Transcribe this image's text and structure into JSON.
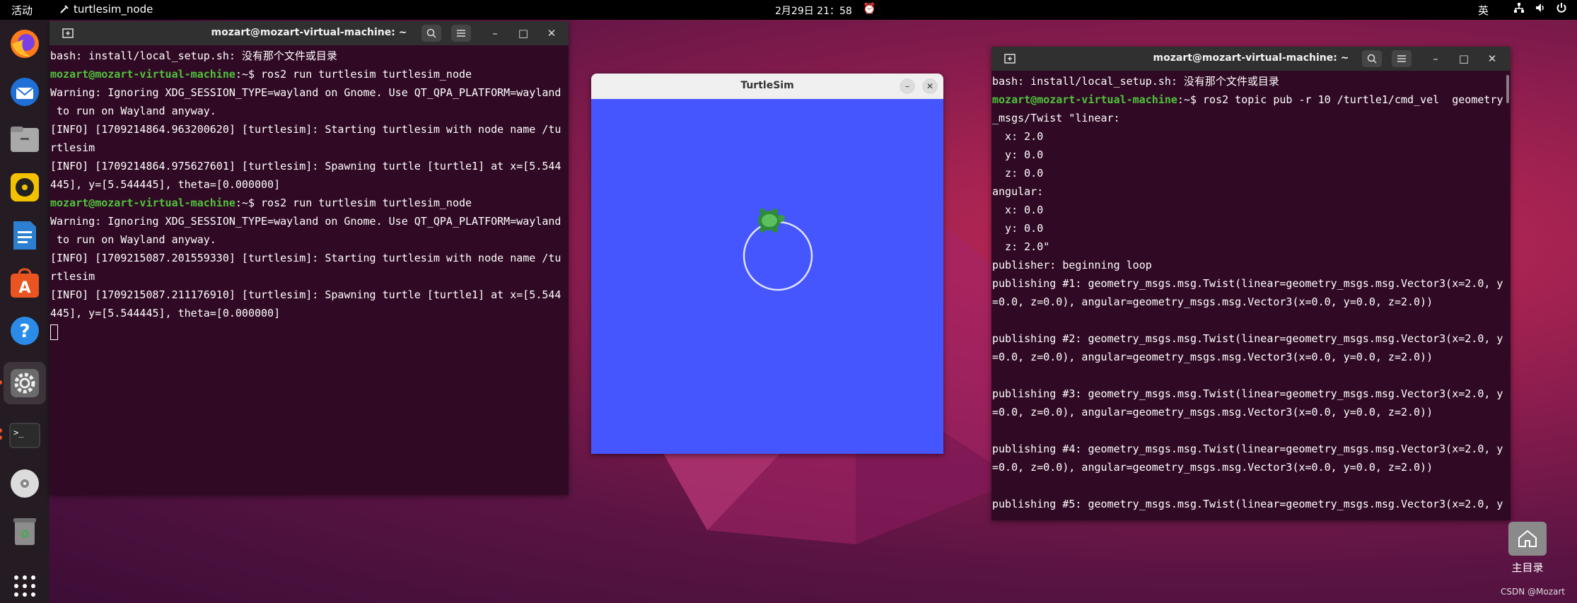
{
  "topbar": {
    "activities": "活动",
    "app_name": "turtlesim_node",
    "clock": "2月29日  21：58",
    "input_method": "英"
  },
  "dock": {
    "items": [
      "firefox-icon",
      "thunderbird-icon",
      "files-icon",
      "rhythmbox-icon",
      "writer-icon",
      "app-center-icon",
      "help-icon",
      "settings-icon",
      "terminal-icon",
      "disc-icon",
      "trash-icon",
      "app-grid-icon"
    ]
  },
  "terminal_left": {
    "title": "mozart@mozart-virtual-machine: ~",
    "lines": [
      {
        "text": "bash: install/local_setup.sh: 没有那个文件或目录"
      },
      {
        "user": "mozart@mozart-virtual-machine",
        "rest": ":~$ ros2 run turtlesim turtlesim_node"
      },
      {
        "text": "Warning: Ignoring XDG_SESSION_TYPE=wayland on Gnome. Use QT_QPA_PLATFORM=wayland"
      },
      {
        "text": " to run on Wayland anyway."
      },
      {
        "text": "[INFO] [1709214864.963200620] [turtlesim]: Starting turtlesim with node name /tu"
      },
      {
        "text": "rtlesim"
      },
      {
        "text": "[INFO] [1709214864.975627601] [turtlesim]: Spawning turtle [turtle1] at x=[5.544"
      },
      {
        "text": "445], y=[5.544445], theta=[0.000000]"
      },
      {
        "user": "mozart@mozart-virtual-machine",
        "rest": ":~$ ros2 run turtlesim turtlesim_node"
      },
      {
        "text": "Warning: Ignoring XDG_SESSION_TYPE=wayland on Gnome. Use QT_QPA_PLATFORM=wayland"
      },
      {
        "text": " to run on Wayland anyway."
      },
      {
        "text": "[INFO] [1709215087.201559330] [turtlesim]: Starting turtlesim with node name /tu"
      },
      {
        "text": "rtlesim"
      },
      {
        "text": "[INFO] [1709215087.211176910] [turtlesim]: Spawning turtle [turtle1] at x=[5.544"
      },
      {
        "text": "445], y=[5.544445], theta=[0.000000]"
      }
    ]
  },
  "turtlesim": {
    "title": "TurtleSim",
    "background_color": "#4556ff"
  },
  "terminal_right": {
    "title": "mozart@mozart-virtual-machine: ~",
    "lines": [
      {
        "text": "bash: install/local_setup.sh: 没有那个文件或目录"
      },
      {
        "user": "mozart@mozart-virtual-machine",
        "rest": ":~$ ros2 topic pub -r 10 /turtle1/cmd_vel  geometry"
      },
      {
        "text": "_msgs/Twist \"linear:"
      },
      {
        "text": "  x: 2.0"
      },
      {
        "text": "  y: 0.0"
      },
      {
        "text": "  z: 0.0"
      },
      {
        "text": "angular:"
      },
      {
        "text": "  x: 0.0"
      },
      {
        "text": "  y: 0.0"
      },
      {
        "text": "  z: 2.0\""
      },
      {
        "text": "publisher: beginning loop"
      },
      {
        "text": "publishing #1: geometry_msgs.msg.Twist(linear=geometry_msgs.msg.Vector3(x=2.0, y"
      },
      {
        "text": "=0.0, z=0.0), angular=geometry_msgs.msg.Vector3(x=0.0, y=0.0, z=2.0))"
      },
      {
        "text": ""
      },
      {
        "text": "publishing #2: geometry_msgs.msg.Twist(linear=geometry_msgs.msg.Vector3(x=2.0, y"
      },
      {
        "text": "=0.0, z=0.0), angular=geometry_msgs.msg.Vector3(x=0.0, y=0.0, z=2.0))"
      },
      {
        "text": ""
      },
      {
        "text": "publishing #3: geometry_msgs.msg.Twist(linear=geometry_msgs.msg.Vector3(x=2.0, y"
      },
      {
        "text": "=0.0, z=0.0), angular=geometry_msgs.msg.Vector3(x=0.0, y=0.0, z=2.0))"
      },
      {
        "text": ""
      },
      {
        "text": "publishing #4: geometry_msgs.msg.Twist(linear=geometry_msgs.msg.Vector3(x=2.0, y"
      },
      {
        "text": "=0.0, z=0.0), angular=geometry_msgs.msg.Vector3(x=0.0, y=0.0, z=2.0))"
      },
      {
        "text": ""
      },
      {
        "text": "publishing #5: geometry_msgs.msg.Twist(linear=geometry_msgs.msg.Vector3(x=2.0, y"
      }
    ]
  },
  "desktop": {
    "home_label": "主目录",
    "watermark": "CSDN @Mozart"
  },
  "colors": {
    "terminal_bg": "#300a24",
    "prompt_green": "#4fc43b",
    "ubuntu_orange": "#e95420"
  }
}
